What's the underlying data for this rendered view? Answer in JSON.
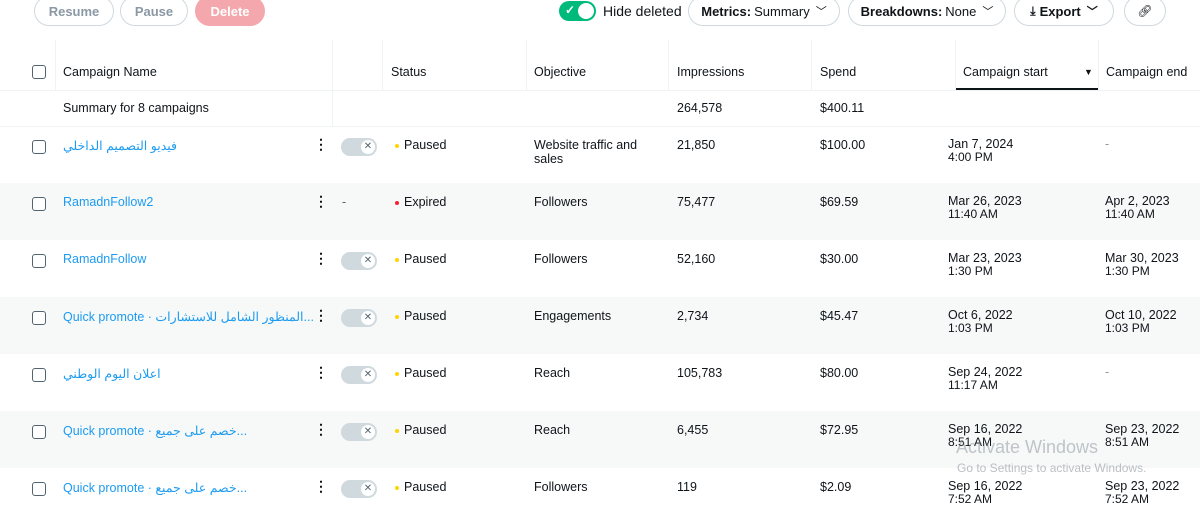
{
  "toolbar": {
    "resume_label": "Resume",
    "pause_label": "Pause",
    "delete_label": "Delete",
    "hide_deleted_label": "Hide deleted",
    "hide_deleted_on": true,
    "metrics_key": "Metrics:",
    "metrics_value": "Summary",
    "breakdowns_key": "Breakdowns:",
    "breakdowns_value": "None",
    "export_label": "Export",
    "export_icon": "download-icon",
    "link_icon": "link-icon"
  },
  "table": {
    "headers": {
      "campaign_name": "Campaign Name",
      "status": "Status",
      "objective": "Objective",
      "impressions": "Impressions",
      "spend": "Spend",
      "campaign_start": "Campaign start",
      "campaign_end": "Campaign end"
    },
    "summary": {
      "label": "Summary for 8 campaigns",
      "impressions": "264,578",
      "spend": "$400.11"
    },
    "rows": [
      {
        "name": "فيديو التصميم الداخلي",
        "rtl": true,
        "toggle": true,
        "status": "Paused",
        "status_color": "#ffd400",
        "objective": "Website traffic and sales",
        "impressions": "21,850",
        "spend": "$100.00",
        "start_date": "Jan 7, 2024",
        "start_time": "4:00 PM",
        "end_date": "-",
        "end_time": ""
      },
      {
        "name": "RamadnFollow2",
        "rtl": false,
        "toggle": false,
        "status": "Expired",
        "status_color": "#f4212e",
        "objective": "Followers",
        "impressions": "75,477",
        "spend": "$69.59",
        "start_date": "Mar 26, 2023",
        "start_time": "11:40 AM",
        "end_date": "Apr 2, 2023",
        "end_time": "11:40 AM"
      },
      {
        "name": "RamadnFollow",
        "rtl": false,
        "toggle": true,
        "status": "Paused",
        "status_color": "#ffd400",
        "objective": "Followers",
        "impressions": "52,160",
        "spend": "$30.00",
        "start_date": "Mar 23, 2023",
        "start_time": "1:30 PM",
        "end_date": "Mar 30, 2023",
        "end_time": "1:30 PM"
      },
      {
        "name": "Quick promote · المنظور الشامل للاستشارات...",
        "rtl": true,
        "toggle": true,
        "status": "Paused",
        "status_color": "#ffd400",
        "objective": "Engagements",
        "impressions": "2,734",
        "spend": "$45.47",
        "start_date": "Oct 6, 2022",
        "start_time": "1:03 PM",
        "end_date": "Oct 10, 2022",
        "end_time": "1:03 PM"
      },
      {
        "name": "اعلان اليوم الوطني",
        "rtl": true,
        "toggle": true,
        "status": "Paused",
        "status_color": "#ffd400",
        "objective": "Reach",
        "impressions": "105,783",
        "spend": "$80.00",
        "start_date": "Sep 24, 2022",
        "start_time": "11:17 AM",
        "end_date": "-",
        "end_time": ""
      },
      {
        "name": "Quick promote · خصم على جميع...",
        "rtl": true,
        "toggle": true,
        "status": "Paused",
        "status_color": "#ffd400",
        "objective": "Reach",
        "impressions": "6,455",
        "spend": "$72.95",
        "start_date": "Sep 16, 2022",
        "start_time": "8:51 AM",
        "end_date": "Sep 23, 2022",
        "end_time": "8:51 AM"
      },
      {
        "name": "Quick promote · خصم على جميع...",
        "rtl": true,
        "toggle": true,
        "status": "Paused",
        "status_color": "#ffd400",
        "objective": "Followers",
        "impressions": "119",
        "spend": "$2.09",
        "start_date": "Sep 16, 2022",
        "start_time": "7:52 AM",
        "end_date": "Sep 23, 2022",
        "end_time": "7:52 AM"
      }
    ]
  },
  "watermark": {
    "title": "Activate Windows",
    "subtitle": "Go to Settings to activate Windows."
  }
}
